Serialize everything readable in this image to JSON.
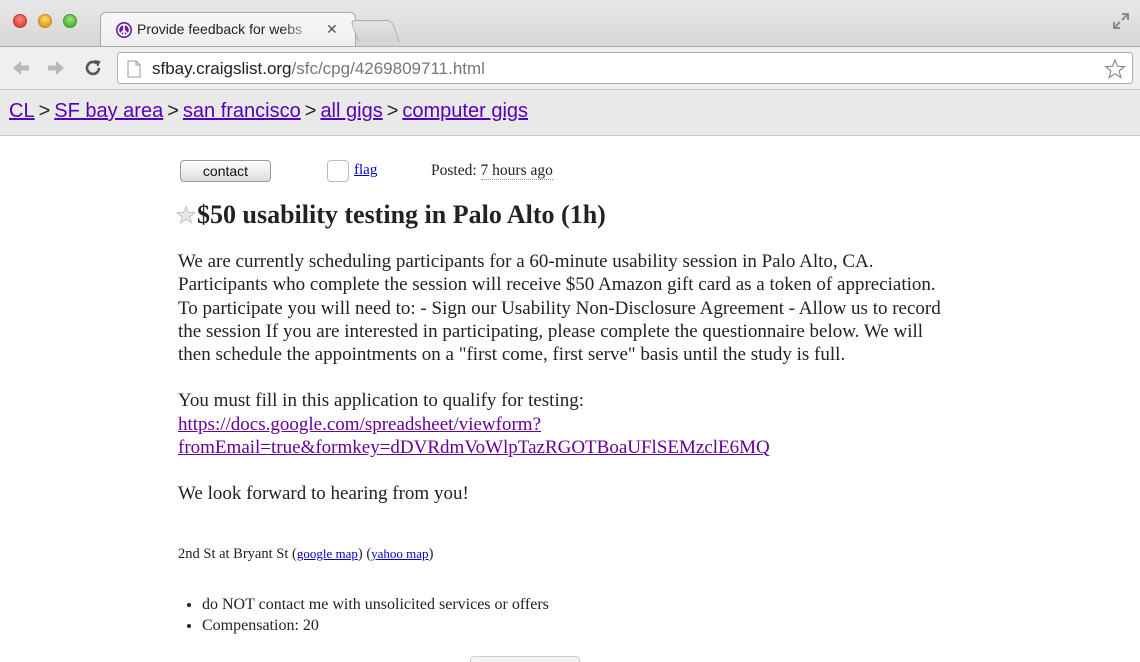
{
  "browser": {
    "tab_title": "Provide feedback for webs",
    "url_host": "sfbay.craigslist.org",
    "url_path": "/sfc/cpg/4269809711.html"
  },
  "breadcrumbs": [
    "CL",
    "SF bay area",
    "san francisco",
    "all gigs",
    "computer gigs"
  ],
  "breadcrumb_separator": ">",
  "posting": {
    "contact_label": "contact",
    "flag_label": "flag",
    "posted_label": "Posted:",
    "posted_ago": "7 hours ago",
    "title": "$50 usability testing in Palo Alto (1h)",
    "paragraph1": "We are currently scheduling participants for a 60-minute usability session in Palo Alto, CA. Participants who complete the session will receive $50 Amazon gift card as a token of appreciation. To participate you will need to: - Sign our Usability Non-Disclosure Agreement - Allow us to record the session If you are interested in participating, please complete the questionnaire below. We will then schedule the appointments on a \"first come, first serve\" basis until the study is full.",
    "paragraph2_intro": "You must fill in this application to qualify for testing:",
    "form_link_line1": "https://docs.google.com/spreadsheet/viewform?",
    "form_link_line2": "fromEmail=true&formkey=dDVRdmVoWlpTazRGOTBoaUFlSEMzclE6MQ",
    "closing": "We look forward to hearing from you!",
    "location": "2nd St at Bryant St",
    "google_map_label": "google map",
    "yahoo_map_label": "yahoo map",
    "notices": [
      "do NOT contact me with unsolicited services or offers",
      "Compensation: 20"
    ]
  },
  "colors": {
    "link_visited": "#660099",
    "breadcrumb_link": "#5500bb",
    "link": "#0000cc"
  },
  "icons": [
    "peace-favicon-icon",
    "close-icon",
    "restore-window-icon",
    "back-arrow-icon",
    "forward-arrow-icon",
    "reload-icon",
    "page-icon",
    "bookmark-star-icon",
    "favorite-star-icon"
  ]
}
